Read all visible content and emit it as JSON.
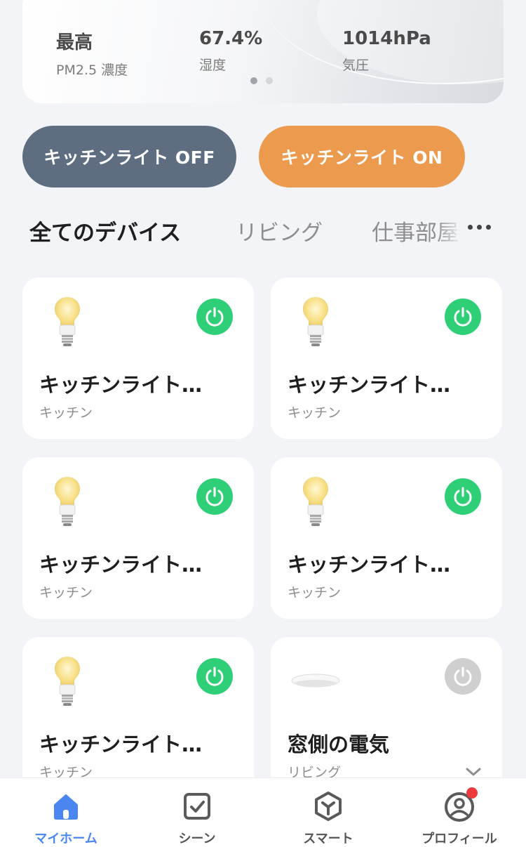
{
  "weather": {
    "stats": [
      {
        "value": "最高",
        "label": "PM2.5 濃度"
      },
      {
        "value": "67.4%",
        "label": "湿度"
      },
      {
        "value": "1014hPa",
        "label": "気圧"
      }
    ],
    "pager": {
      "count": 2,
      "active": 1
    }
  },
  "scenes": {
    "off_label": "キッチンライト OFF",
    "on_label": "キッチンライト ON",
    "off_color": "#5e6e80",
    "on_color": "#ec9a4d"
  },
  "tabs": [
    {
      "label": "全てのデバイス",
      "active": true
    },
    {
      "label": "リビング",
      "active": false
    },
    {
      "label": "仕事部屋",
      "active": false
    }
  ],
  "devices": [
    {
      "name": "キッチンライト…",
      "room": "キッチン",
      "icon": "bulb-icon",
      "power": "on"
    },
    {
      "name": "キッチンライト…",
      "room": "キッチン",
      "icon": "bulb-icon",
      "power": "on"
    },
    {
      "name": "キッチンライト…",
      "room": "キッチン",
      "icon": "bulb-icon",
      "power": "on"
    },
    {
      "name": "キッチンライト…",
      "room": "キッチン",
      "icon": "bulb-icon",
      "power": "on"
    },
    {
      "name": "キッチンライト…",
      "room": "キッチン",
      "icon": "bulb-icon",
      "power": "on"
    },
    {
      "name": "窓側の電気",
      "room": "リビング",
      "icon": "ceiling-light-icon",
      "power": "off"
    }
  ],
  "nav": [
    {
      "label": "マイホーム",
      "icon": "home-icon",
      "active": true
    },
    {
      "label": "シーン",
      "icon": "scene-checkbox-icon",
      "active": false
    },
    {
      "label": "スマート",
      "icon": "smart-cube-icon",
      "active": false
    },
    {
      "label": "プロフィール",
      "icon": "profile-icon",
      "active": false,
      "badge": true
    }
  ],
  "colors": {
    "power_on": "#2fcf78",
    "power_off": "#cfcfcf",
    "accent": "#4a86f0",
    "badge": "#ef3b3b"
  }
}
